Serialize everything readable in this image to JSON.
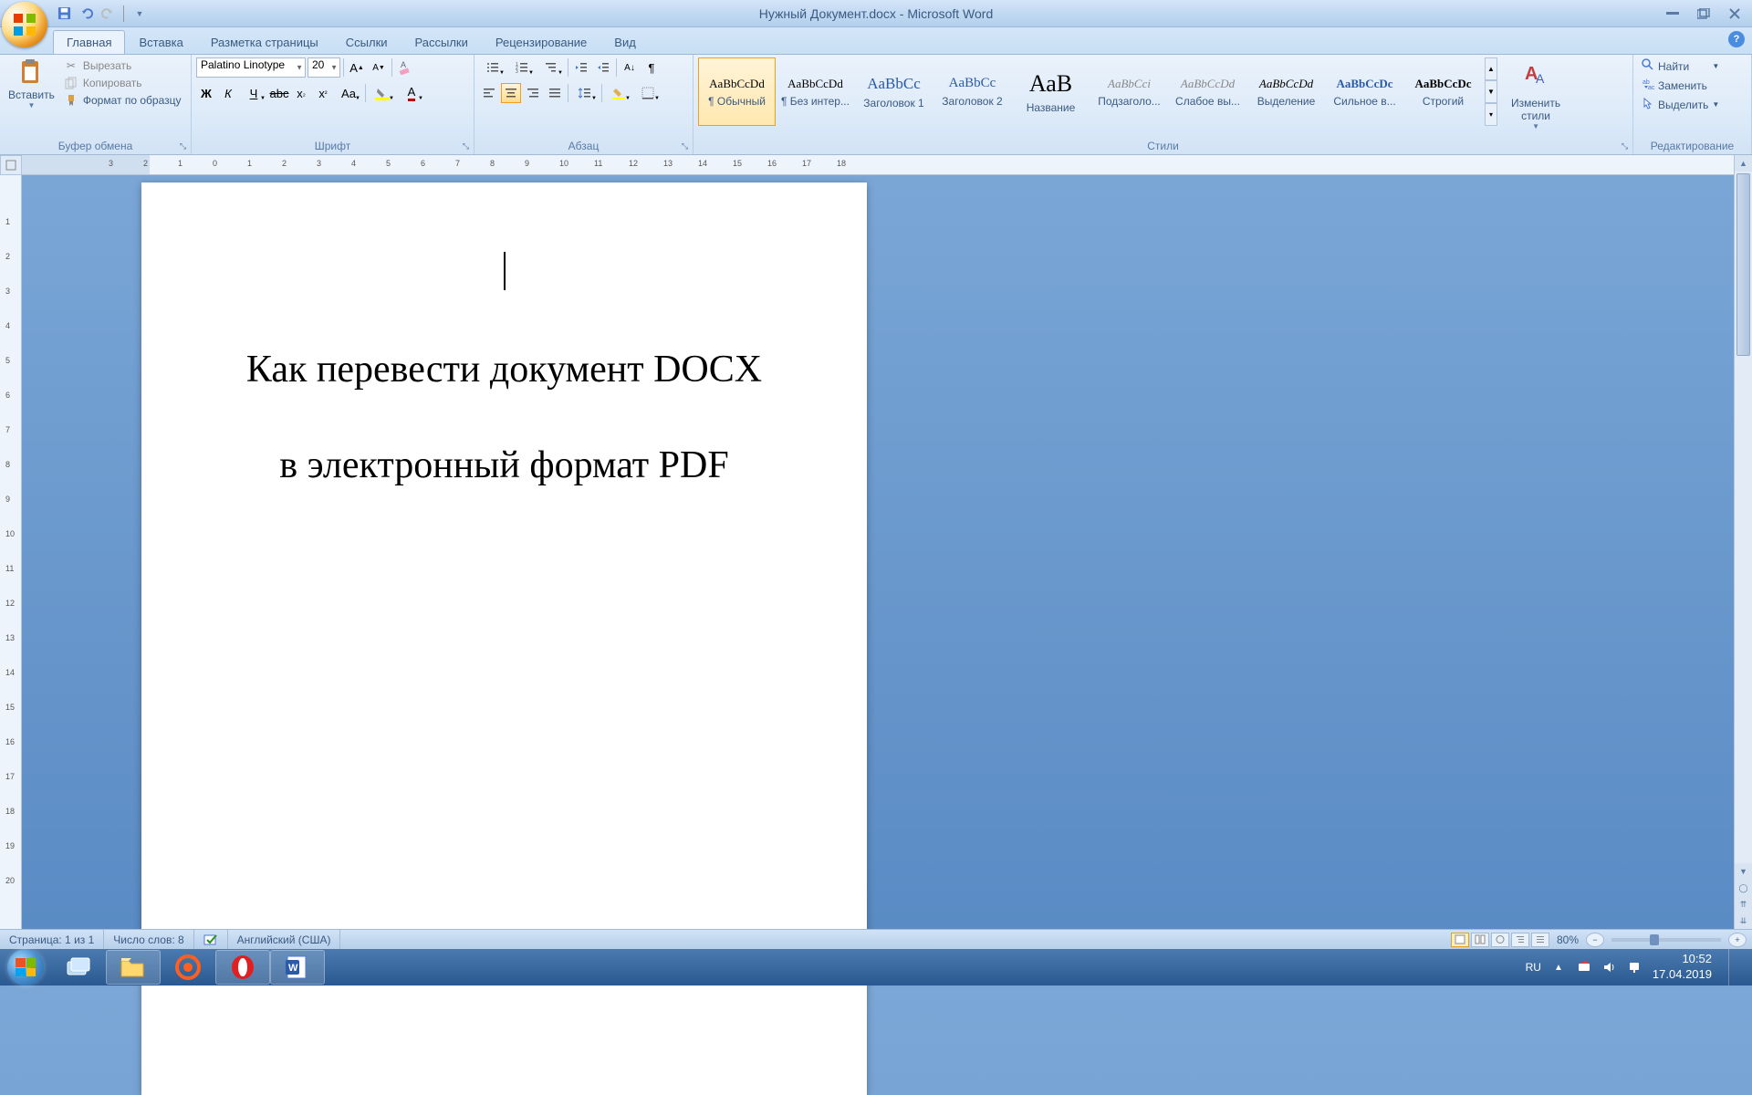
{
  "window": {
    "title": "Нужный Документ.docx - Microsoft Word"
  },
  "tabs": [
    "Главная",
    "Вставка",
    "Разметка страницы",
    "Ссылки",
    "Рассылки",
    "Рецензирование",
    "Вид"
  ],
  "clipboard": {
    "paste": "Вставить",
    "cut": "Вырезать",
    "copy": "Копировать",
    "format_painter": "Формат по образцу",
    "group": "Буфер обмена"
  },
  "font": {
    "name": "Palatino Linotype",
    "size": "20",
    "group": "Шрифт"
  },
  "paragraph": {
    "group": "Абзац"
  },
  "styles": {
    "group": "Стили",
    "items": [
      {
        "preview": "AaBbCcDd",
        "name": "¶ Обычный",
        "color": "#000",
        "fs": "13"
      },
      {
        "preview": "AaBbCcDd",
        "name": "¶ Без интер...",
        "color": "#000",
        "fs": "13"
      },
      {
        "preview": "AaBbCc",
        "name": "Заголовок 1",
        "color": "#2a5aa8",
        "fs": "17"
      },
      {
        "preview": "AaBbCc",
        "name": "Заголовок 2",
        "color": "#2a5aa8",
        "fs": "15"
      },
      {
        "preview": "АаВ",
        "name": "Название",
        "color": "#000",
        "fs": "26"
      },
      {
        "preview": "AaBbCci",
        "name": "Подзаголо...",
        "color": "#888",
        "fs": "13"
      },
      {
        "preview": "AaBbCcDd",
        "name": "Слабое вы...",
        "color": "#888",
        "fs": "13"
      },
      {
        "preview": "AaBbCcDd",
        "name": "Выделение",
        "color": "#000",
        "fs": "13"
      },
      {
        "preview": "AaBbCcDc",
        "name": "Сильное в...",
        "color": "#2a5aa8",
        "fs": "13"
      },
      {
        "preview": "AaBbCcDc",
        "name": "Строгий",
        "color": "#000",
        "fs": "13"
      }
    ],
    "change": "Изменить\nстили"
  },
  "editing": {
    "group": "Редактирование",
    "find": "Найти",
    "replace": "Заменить",
    "select": "Выделить"
  },
  "document": {
    "line1": "Как перевести документ DOCX",
    "line2": "в электронный формат PDF"
  },
  "status": {
    "page": "Страница: 1 из 1",
    "words": "Число слов: 8",
    "lang": "Английский (США)",
    "zoom": "80%"
  },
  "systray": {
    "lang": "RU",
    "time": "10:52",
    "date": "17.04.2019"
  }
}
